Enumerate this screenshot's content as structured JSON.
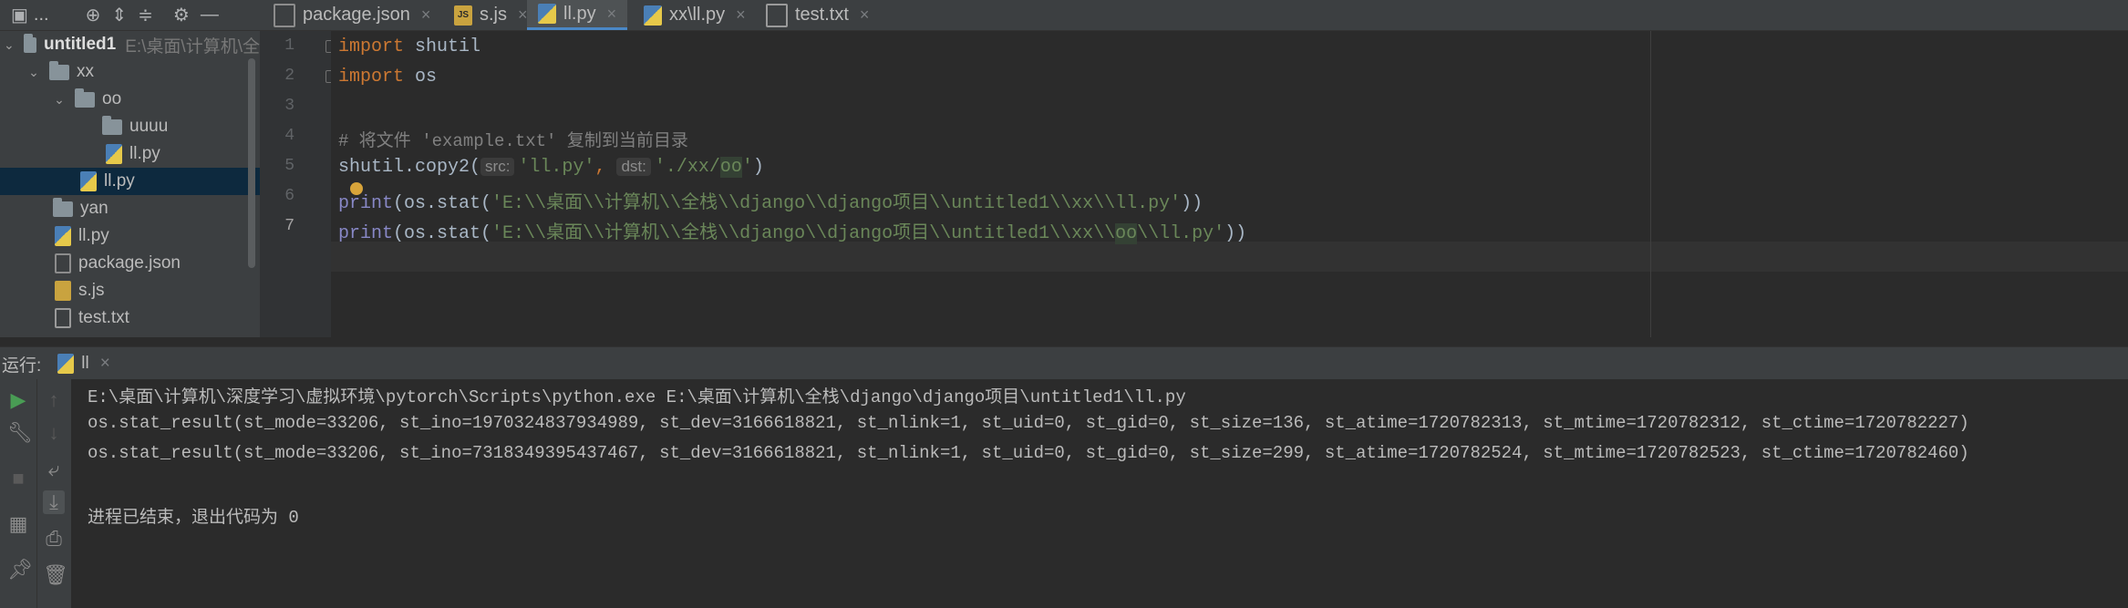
{
  "toolbar": {
    "project_label": "...",
    "icons": [
      "project-icon",
      "crosshair-icon",
      "expand-all-icon",
      "collapse-all-icon",
      "gear-icon",
      "minimize-icon"
    ]
  },
  "tabs": [
    {
      "label": "package.json",
      "icon": "json-file-icon"
    },
    {
      "label": "s.js",
      "icon": "js-file-icon"
    },
    {
      "label": "ll.py",
      "icon": "python-file-icon",
      "active": true
    },
    {
      "label": "xx\\ll.py",
      "icon": "python-file-icon"
    },
    {
      "label": "test.txt",
      "icon": "text-file-icon"
    }
  ],
  "tree": {
    "root_label": "untitled1",
    "root_path": "E:\\桌面\\计算机\\全",
    "items": [
      {
        "label": "xx"
      },
      {
        "label": "oo"
      },
      {
        "label": "uuuu"
      },
      {
        "label": "ll.py"
      },
      {
        "label": "ll.py"
      },
      {
        "label": "yan"
      },
      {
        "label": "ll.py"
      },
      {
        "label": "package.json"
      },
      {
        "label": "s.js"
      },
      {
        "label": "test.txt"
      }
    ]
  },
  "editor": {
    "line_numbers": [
      "1",
      "2",
      "3",
      "4",
      "5",
      "6",
      "7"
    ],
    "l1_kw": "import",
    "l1_rest": " shutil",
    "l2_kw": "import",
    "l2_rest": " os",
    "l4_comment": "# 将文件 'example.txt' 复制到当前目录",
    "l5_a": "shutil.copy2(",
    "l5_hint1": "src:",
    "l5_s1": "'ll.py'",
    "l5_comma": ", ",
    "l5_hint2": "dst:",
    "l5_s2a": "'./xx/",
    "l5_s2b": "oo",
    "l5_s2c": "'",
    "l5_end": ")",
    "l6_fn": "print",
    "l6_a": "(os.stat(",
    "l6_s": "'E:\\\\桌面\\\\计算机\\\\全栈\\\\django\\\\django项目\\\\untitled1\\\\xx\\\\ll.py'",
    "l6_end": "))",
    "l7_fn": "print",
    "l7_a": "(os.stat(",
    "l7_s1": "'E:\\\\桌面\\\\计算机\\\\全栈\\\\django\\\\django项目\\\\untitled1\\\\xx\\\\",
    "l7_s2": "oo",
    "l7_s3": "\\\\ll.py'",
    "l7_end": "))"
  },
  "run": {
    "label": "运行:",
    "tab_label": "ll",
    "lines": [
      "E:\\桌面\\计算机\\深度学习\\虚拟环境\\pytorch\\Scripts\\python.exe E:\\桌面\\计算机\\全栈\\django\\django项目\\untitled1\\ll.py",
      "os.stat_result(st_mode=33206, st_ino=1970324837934989, st_dev=3166618821, st_nlink=1, st_uid=0, st_gid=0, st_size=136, st_atime=1720782313, st_mtime=1720782312, st_ctime=1720782227)",
      "os.stat_result(st_mode=33206, st_ino=7318349395437467, st_dev=3166618821, st_nlink=1, st_uid=0, st_gid=0, st_size=299, st_atime=1720782524, st_mtime=1720782523, st_ctime=1720782460)",
      "",
      "进程已结束，退出代码为 0"
    ]
  }
}
